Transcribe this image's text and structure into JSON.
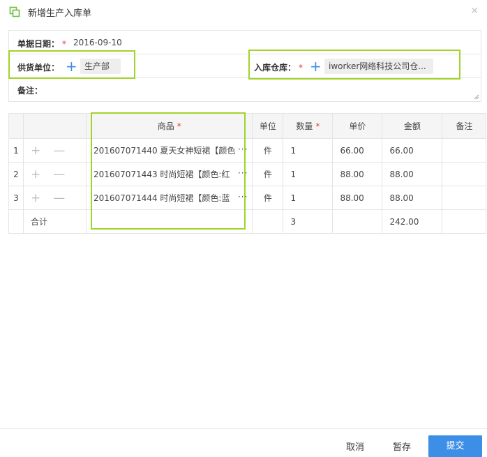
{
  "dialog": {
    "title": "新增生产入库单"
  },
  "form": {
    "date_label": "单据日期：",
    "date_value": "2016-09-10",
    "supplier_label": "供货单位：",
    "supplier_value": "生产部",
    "warehouse_label": "入库仓库：",
    "warehouse_value": "iworker网络科技公司仓...",
    "remark_label": "备注：",
    "required_mark": "*"
  },
  "table": {
    "headers": {
      "goods": "商品",
      "unit": "单位",
      "quantity": "数量",
      "price": "单价",
      "amount": "金额",
      "remark": "备注"
    },
    "rows": [
      {
        "index": "1",
        "goods": "201607071440 夏天女神短裙【颜色",
        "unit": "件",
        "quantity": "1",
        "price": "66.00",
        "amount": "66.00"
      },
      {
        "index": "2",
        "goods": "201607071443 时尚短裙【颜色:红",
        "unit": "件",
        "quantity": "1",
        "price": "88.00",
        "amount": "88.00"
      },
      {
        "index": "3",
        "goods": "201607071444 时尚短裙【颜色:蓝",
        "unit": "件",
        "quantity": "1",
        "price": "88.00",
        "amount": "88.00"
      }
    ],
    "total": {
      "label": "合计",
      "quantity": "3",
      "amount": "242.00"
    },
    "add_symbol": "+",
    "remove_symbol": "—",
    "more_symbol": "···"
  },
  "footer": {
    "cancel_label": "取消",
    "save_label": "暂存",
    "submit_label": "提交"
  },
  "colors": {
    "accent": "#3d8ee6",
    "highlight": "#a2d32a",
    "required": "#e4393c",
    "icon": "#6bbf3a"
  }
}
